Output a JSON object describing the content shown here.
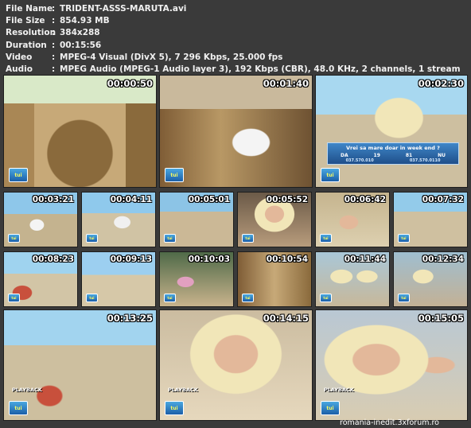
{
  "file_info": [
    {
      "label": "File Name",
      "sep": ":",
      "value": "TRIDENT-ASSS-MARUTA.avi"
    },
    {
      "label": "File Size",
      "sep": ":",
      "value": "854.93 MB"
    },
    {
      "label": "Resolution",
      "sep": ":",
      "value": "384x288"
    },
    {
      "label": "Duration",
      "sep": ":",
      "value": "00:15:56"
    },
    {
      "label": "Video",
      "sep": ":",
      "value": "MPEG-4 Visual (DivX 5), 7 296 Kbps, 25.000 fps"
    },
    {
      "label": "Audio",
      "sep": ":",
      "value": "MPEG Audio (MPEG-1 Audio layer 3), 192 Kbps (CBR), 48.0 KHz, 2 channels, 1 stream"
    }
  ],
  "thumbnails": [
    {
      "timestamp": "00:00:50",
      "scene": "terrace",
      "logo": "tui"
    },
    {
      "timestamp": "00:01:40",
      "scene": "hut",
      "logo": "tui"
    },
    {
      "timestamp": "00:02:30",
      "scene": "blonde-beach",
      "logo": "tui"
    },
    {
      "timestamp": "00:03:21",
      "scene": "crowd",
      "logo": "tui"
    },
    {
      "timestamp": "00:04:11",
      "scene": "man-beach",
      "logo": "tui"
    },
    {
      "timestamp": "00:05:01",
      "scene": "dancers",
      "logo": "tui"
    },
    {
      "timestamp": "00:05:52",
      "scene": "singer-close",
      "logo": "tui"
    },
    {
      "timestamp": "00:06:42",
      "scene": "sand-girl",
      "logo": "tui"
    },
    {
      "timestamp": "00:07:32",
      "scene": "beach-wide",
      "logo": "tui"
    },
    {
      "timestamp": "00:08:23",
      "scene": "boat",
      "logo": "tui"
    },
    {
      "timestamp": "00:09:13",
      "scene": "beach-ppl",
      "logo": "tui"
    },
    {
      "timestamp": "00:10:03",
      "scene": "crowd2",
      "logo": "tui"
    },
    {
      "timestamp": "00:10:54",
      "scene": "hut2",
      "logo": "tui"
    },
    {
      "timestamp": "00:11:44",
      "scene": "singer-mic",
      "logo": "tui"
    },
    {
      "timestamp": "00:12:34",
      "scene": "singer-dancers",
      "logo": "tui"
    },
    {
      "timestamp": "00:13:25",
      "scene": "boat-wide",
      "logo": "tui",
      "overlay": "PLAYBACK"
    },
    {
      "timestamp": "00:14:15",
      "scene": "singer-big",
      "logo": "tui",
      "overlay": "PLAYBACK"
    },
    {
      "timestamp": "00:15:05",
      "scene": "singer-big2",
      "logo": "tui",
      "overlay": "PLAYBACK"
    }
  ],
  "logo_text": "tui",
  "poll_banner": {
    "title": "Vrei sa mare doar in week end ?",
    "options": [
      "DA",
      "NU"
    ],
    "numbers": [
      "037.570.010",
      "037.570.0110"
    ],
    "counts": [
      "19",
      "81"
    ]
  },
  "watermark": "romania-inedit.3xforum.ro",
  "colors": {
    "background": "#3a3a3a",
    "text": "#f0f0f0",
    "sky": "#9fd0ef",
    "sand": "#d8c9a6",
    "wood": "#8a6a3c",
    "skin": "#e3b89a",
    "hair": "#f1e6b8"
  }
}
